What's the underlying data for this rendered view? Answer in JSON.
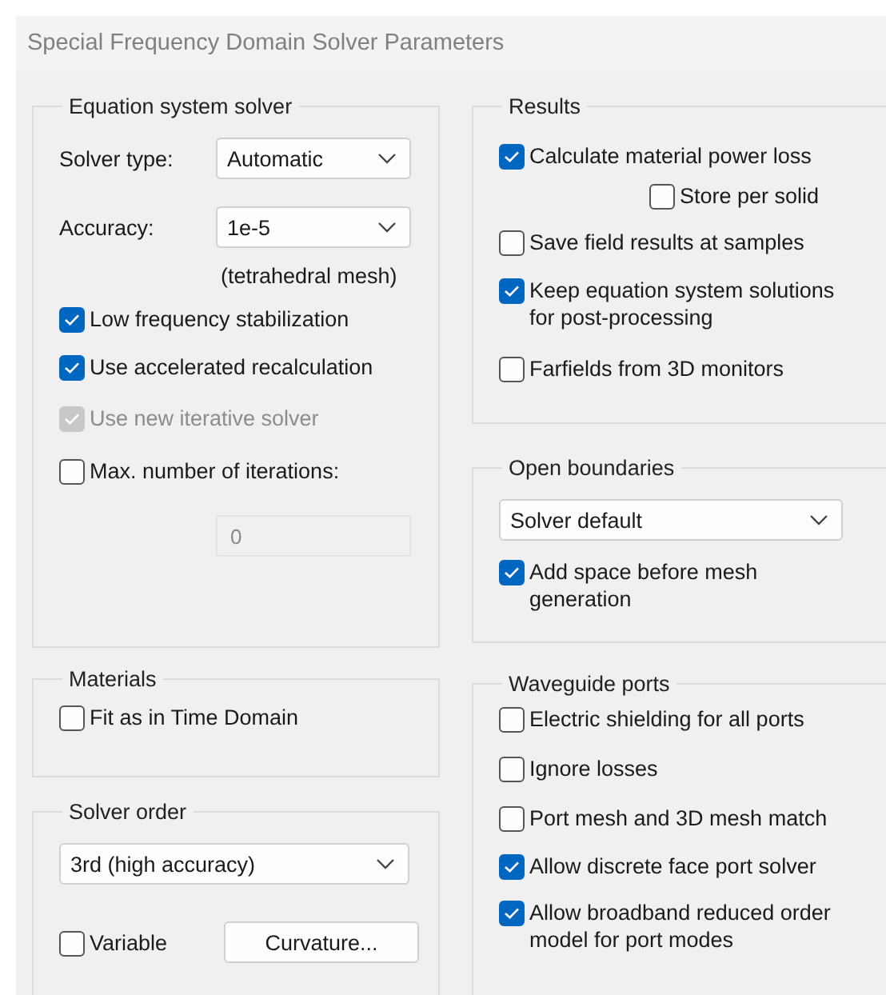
{
  "window": {
    "title": "Special Frequency Domain Solver Parameters"
  },
  "equation_system_solver": {
    "title": "Equation system solver",
    "solver_type": {
      "label": "Solver type:",
      "value": "Automatic"
    },
    "accuracy": {
      "label": "Accuracy:",
      "value": "1e-5",
      "note": "(tetrahedral mesh)"
    },
    "options": [
      {
        "label": "Low frequency stabilization",
        "checked": true,
        "disabled": false
      },
      {
        "label": "Use accelerated recalculation",
        "checked": true,
        "disabled": false
      },
      {
        "label": "Use new iterative solver",
        "checked": true,
        "disabled": true
      },
      {
        "label": "Max. number of iterations:",
        "checked": false,
        "disabled": false
      }
    ],
    "max_iterations": {
      "value": "0",
      "disabled": true
    }
  },
  "materials": {
    "title": "Materials",
    "options": [
      {
        "label": "Fit as in Time Domain",
        "checked": false,
        "disabled": false
      }
    ]
  },
  "solver_order": {
    "title": "Solver order",
    "value": "3rd (high accuracy)",
    "variable": {
      "label": "Variable",
      "checked": false,
      "disabled": false
    },
    "button": "Curvature..."
  },
  "results": {
    "title": "Results",
    "options": [
      {
        "kind": "option",
        "label": "Calculate material power loss",
        "checked": true,
        "disabled": false
      },
      {
        "kind": "sub_option",
        "label": "Store per solid",
        "checked": false,
        "disabled": false
      },
      {
        "kind": "option",
        "label": "Save field results at samples",
        "checked": false,
        "disabled": false
      },
      {
        "kind": "option",
        "label": "Keep equation system solutions for post-processing",
        "checked": true,
        "disabled": false
      },
      {
        "kind": "option",
        "label": "Farfields from 3D monitors",
        "checked": false,
        "disabled": false
      }
    ]
  },
  "open_boundaries": {
    "title": "Open boundaries",
    "value": "Solver default",
    "options": [
      {
        "label": "Add space before mesh generation",
        "checked": true,
        "disabled": false
      }
    ]
  },
  "waveguide_ports": {
    "title": "Waveguide ports",
    "options": [
      {
        "label": "Electric shielding for all ports",
        "checked": false,
        "disabled": false
      },
      {
        "label": "Ignore losses",
        "checked": false,
        "disabled": false
      },
      {
        "label": "Port mesh and 3D mesh match",
        "checked": false,
        "disabled": false
      },
      {
        "label": "Allow discrete face port solver",
        "checked": true,
        "disabled": false
      },
      {
        "label": "Allow broadband reduced order model for port modes",
        "checked": true,
        "disabled": false
      }
    ]
  }
}
